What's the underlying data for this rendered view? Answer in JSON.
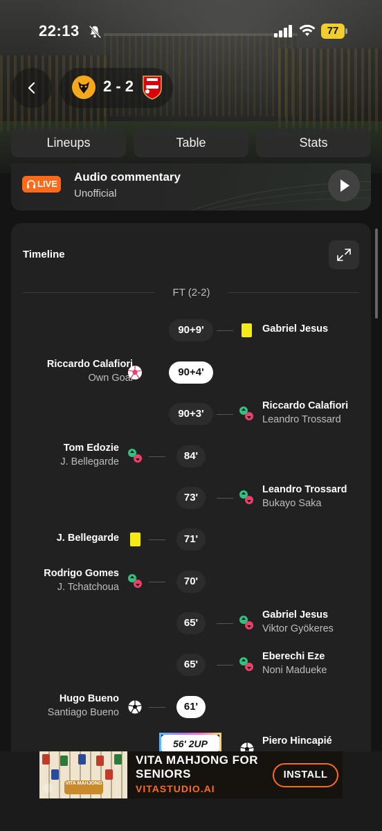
{
  "status_bar": {
    "time": "22:13",
    "battery": "77"
  },
  "match": {
    "score": "2 - 2",
    "home_crest": "wolves-crest-icon",
    "away_crest": "arsenal-crest-icon"
  },
  "tabs": [
    {
      "label": "Lineups"
    },
    {
      "label": "Table"
    },
    {
      "label": "Stats"
    }
  ],
  "audio": {
    "badge": "LIVE",
    "title": "Audio commentary",
    "subtitle": "Unofficial"
  },
  "timeline": {
    "title": "Timeline",
    "ft_label": "FT (2-2)",
    "events": [
      {
        "side": "away",
        "minute": "90+9'",
        "type": "yellow-card",
        "name": "Gabriel Jesus",
        "sub": ""
      },
      {
        "side": "home",
        "minute": "90+4'",
        "type": "own-goal",
        "name": "Riccardo Calafiori",
        "sub": "Own Goal",
        "highlight": true
      },
      {
        "side": "away",
        "minute": "90+3'",
        "type": "substitution",
        "name": "Riccardo Calafiori",
        "sub": "Leandro Trossard"
      },
      {
        "side": "home",
        "minute": "84'",
        "type": "substitution",
        "name": "Tom Edozie",
        "sub": "J. Bellegarde"
      },
      {
        "side": "away",
        "minute": "73'",
        "type": "substitution",
        "name": "Leandro Trossard",
        "sub": "Bukayo Saka"
      },
      {
        "side": "home",
        "minute": "71'",
        "type": "yellow-card",
        "name": "J. Bellegarde",
        "sub": ""
      },
      {
        "side": "home",
        "minute": "70'",
        "type": "substitution",
        "name": "Rodrigo Gomes",
        "sub": "J. Tchatchoua"
      },
      {
        "side": "away",
        "minute": "65'",
        "type": "substitution",
        "name": "Gabriel Jesus",
        "sub": "Viktor Gyökeres"
      },
      {
        "side": "away",
        "minute": "65'",
        "type": "substitution",
        "name": "Eberechi Eze",
        "sub": "Noni Madueke"
      },
      {
        "side": "home",
        "minute": "61'",
        "type": "goal",
        "name": "Hugo Bueno",
        "sub": "Santiago Bueno",
        "highlight": true
      },
      {
        "side": "away",
        "minute": "56' 2UP",
        "type": "goal",
        "name": "Piero Hincapié",
        "sub": ""
      }
    ]
  },
  "ad": {
    "title_line1": "VITA MAHJONG FOR",
    "title_line2": "SENIORS",
    "url": "VITASTUDIO.AI",
    "button": "INSTALL",
    "image_text": "VITA MAHJONG"
  },
  "colors": {
    "live": "#ff6a1a",
    "yellow_card": "#f4ea14",
    "sub_in": "#2ec27e",
    "sub_out": "#e8426a",
    "ad_accent": "#ff6b1a"
  }
}
